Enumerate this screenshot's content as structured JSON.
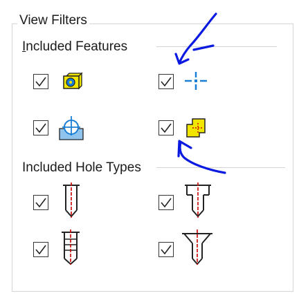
{
  "group": {
    "title": "View Filters"
  },
  "features": {
    "title_mnemonic": "I",
    "title_rest": "ncluded Features",
    "items": [
      {
        "checked": true,
        "icon": "solid-body-feature-icon"
      },
      {
        "checked": true,
        "icon": "point-feature-icon"
      },
      {
        "checked": true,
        "icon": "hole-on-face-feature-icon"
      },
      {
        "checked": true,
        "icon": "sketch-point-feature-icon"
      }
    ]
  },
  "holes": {
    "title": "Included Hole Types",
    "items": [
      {
        "checked": true,
        "icon": "simple-hole-icon"
      },
      {
        "checked": true,
        "icon": "counterbore-hole-icon"
      },
      {
        "checked": true,
        "icon": "tapped-hole-icon"
      },
      {
        "checked": true,
        "icon": "countersink-hole-icon"
      }
    ]
  },
  "colors": {
    "annotation": "#0a1ae0",
    "accent_blue": "#1a7fd4",
    "feature_yellow": "#f2e600",
    "hole_red": "#cc0000"
  }
}
